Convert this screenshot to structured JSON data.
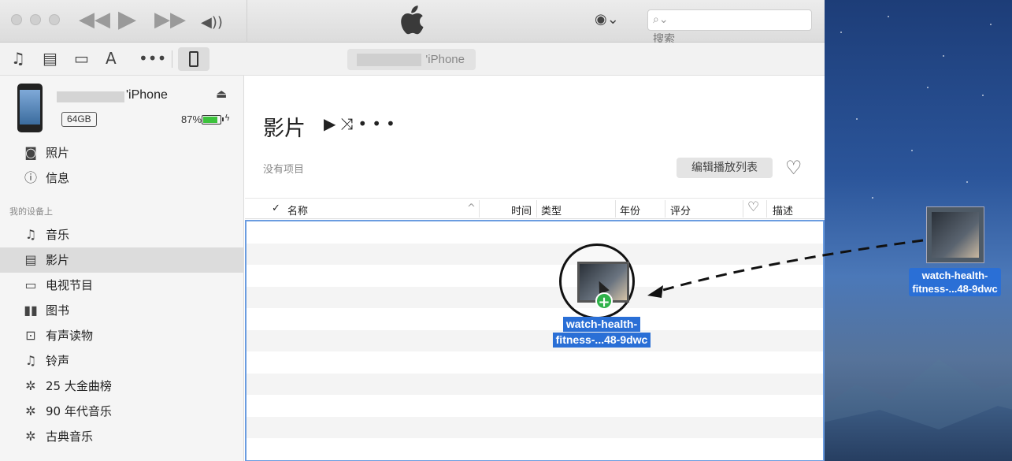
{
  "titlebar": {
    "search_placeholder": "搜索"
  },
  "toolbar": {
    "device_name_suffix": "'iPhone"
  },
  "device": {
    "name_suffix": "'iPhone",
    "capacity": "64GB",
    "battery_pct": "87%",
    "battery_level": 0.87
  },
  "sidebar": {
    "device_items": [
      {
        "icon": "camera-icon",
        "label": "照片"
      },
      {
        "icon": "info-icon",
        "label": "信息"
      }
    ],
    "section_heading": "我的设备上",
    "library_items": [
      {
        "icon": "music-note-icon",
        "label": "音乐"
      },
      {
        "icon": "film-icon",
        "label": "影片",
        "selected": true
      },
      {
        "icon": "tv-icon",
        "label": "电视节目"
      },
      {
        "icon": "book-icon",
        "label": "图书"
      },
      {
        "icon": "audiobook-icon",
        "label": "有声读物"
      },
      {
        "icon": "bell-icon",
        "label": "铃声"
      },
      {
        "icon": "gear-icon",
        "label": "25 大金曲榜"
      },
      {
        "icon": "gear-icon",
        "label": "90 年代音乐"
      },
      {
        "icon": "gear-icon",
        "label": "古典音乐"
      }
    ]
  },
  "main": {
    "title": "影片",
    "no_items": "没有项目",
    "edit_playlist": "编辑播放列表",
    "columns": [
      "名称",
      "时间",
      "类型",
      "年份",
      "评分",
      "描述"
    ]
  },
  "drag": {
    "label_line1": "watch-health-",
    "label_line2": "fitness-...48-9dwc"
  },
  "desktop_file": {
    "label_line1": "watch-health-",
    "label_line2": "fitness-...48-9dwc"
  },
  "colors": {
    "selection_blue": "#2a6fd6",
    "drop_border": "#6a9ce0",
    "plus_green": "#2fb24a"
  }
}
